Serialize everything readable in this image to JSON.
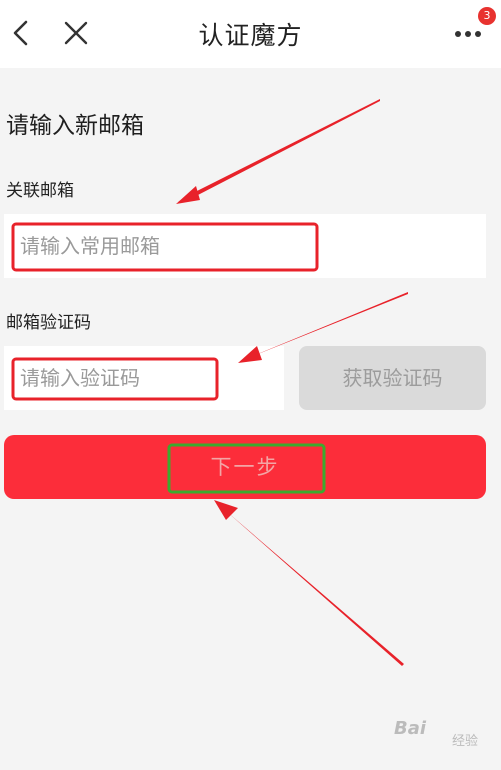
{
  "header": {
    "title": "认证魔方",
    "badge_count": "3"
  },
  "form": {
    "heading": "请输入新邮箱",
    "email_label": "关联邮箱",
    "email_placeholder": "请输入常用邮箱",
    "code_label": "邮箱验证码",
    "code_placeholder": "请输入验证码",
    "get_code_label": "获取验证码",
    "next_label": "下一步"
  },
  "colors": {
    "primary_red": "#fc2d3a",
    "annotation_red": "#e8222a",
    "annotation_green": "#3caa2e",
    "disabled_gray": "#dadada"
  },
  "watermark": {
    "brand": "Bai",
    "suffix": "经验"
  }
}
